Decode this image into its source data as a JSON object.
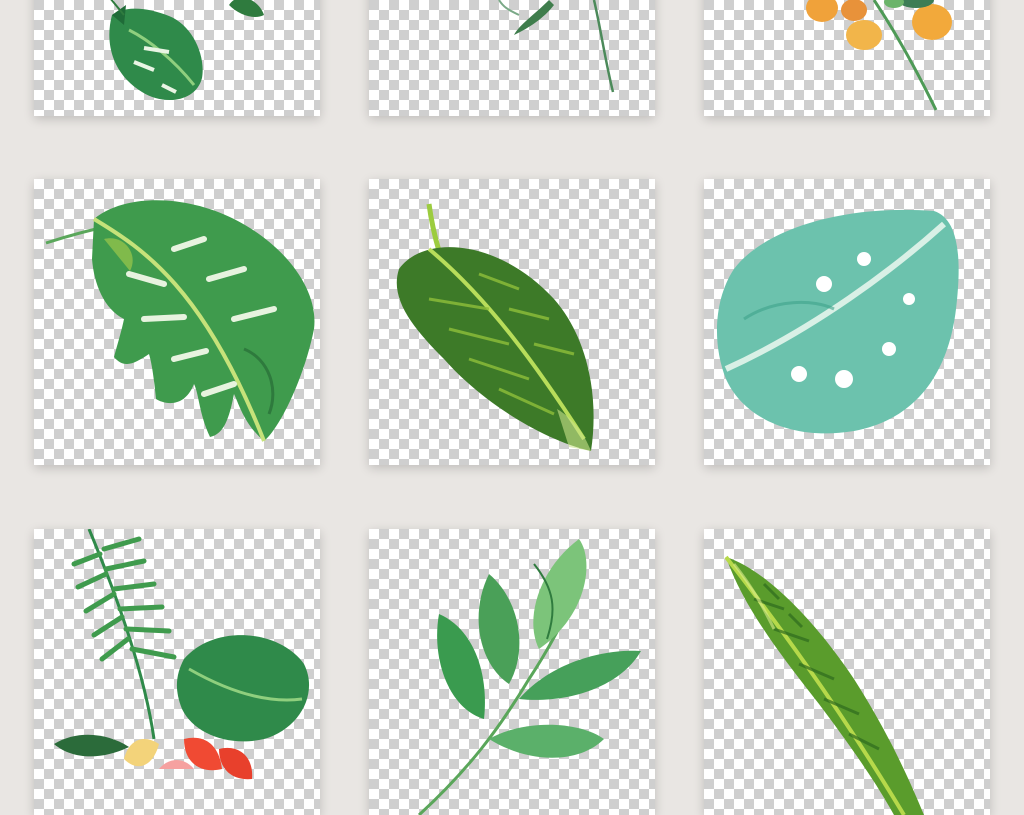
{
  "gallery": {
    "background": "#e9e6e3",
    "checker_colors": [
      "#ffffff",
      "#cfcfcf"
    ],
    "tiles": [
      {
        "subject": "monstera-leaf-small",
        "palette": [
          "#2f8a4a",
          "#1f6b38"
        ]
      },
      {
        "subject": "thin-green-stems",
        "palette": [
          "#4c8a5a",
          "#7aa987"
        ]
      },
      {
        "subject": "orange-berry-branch",
        "palette": [
          "#f2a93b",
          "#4e9a56"
        ]
      },
      {
        "subject": "monstera-leaf",
        "palette": [
          "#3f9b4d",
          "#9cc84a"
        ]
      },
      {
        "subject": "banana-leaf",
        "palette": [
          "#3d7a28",
          "#9ccc3f"
        ]
      },
      {
        "subject": "teal-monstera-leaf",
        "palette": [
          "#6cc2ad",
          "#3ea28a"
        ]
      },
      {
        "subject": "palm-and-flowers-bouquet",
        "palette": [
          "#2f8a4a",
          "#f04a33"
        ]
      },
      {
        "subject": "green-leaf-sprig",
        "palette": [
          "#3a9b4f",
          "#7cc47a"
        ]
      },
      {
        "subject": "long-banana-leaf",
        "palette": [
          "#5a9c2c",
          "#b6d94a"
        ]
      }
    ]
  }
}
